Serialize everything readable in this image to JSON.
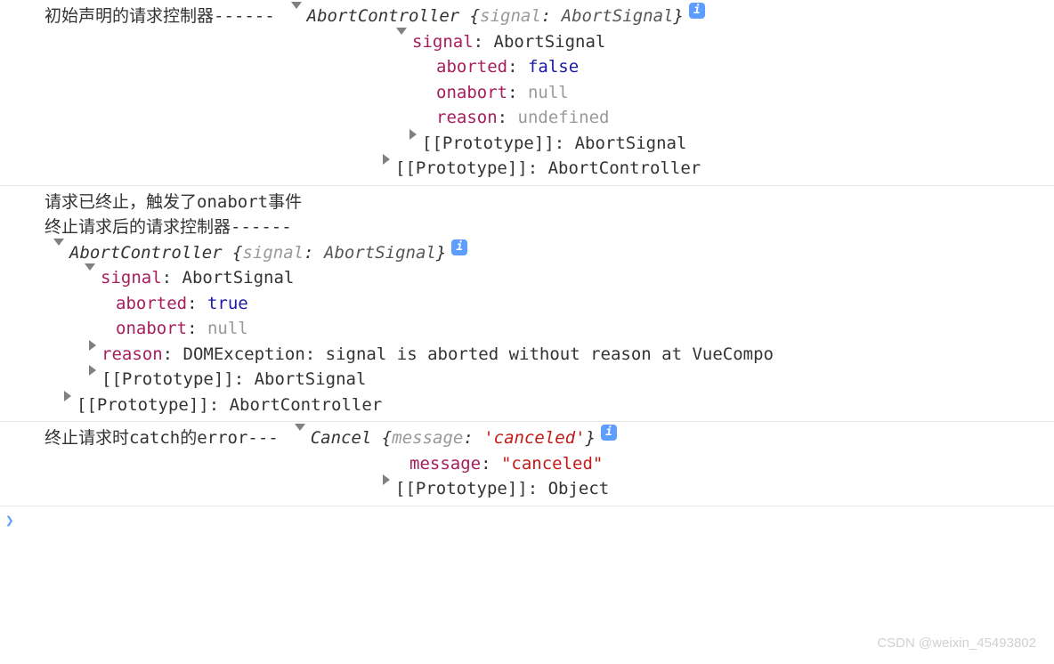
{
  "entry1": {
    "prefix": "初始声明的请求控制器------",
    "objName": "AbortController",
    "summaryKey": "signal",
    "summaryVal": "AbortSignal",
    "signal": {
      "key": "signal",
      "type": "AbortSignal",
      "aborted": {
        "key": "aborted",
        "val": "false"
      },
      "onabort": {
        "key": "onabort",
        "val": "null"
      },
      "reason": {
        "key": "reason",
        "val": "undefined"
      },
      "proto": {
        "key": "[[Prototype]]",
        "val": "AbortSignal"
      }
    },
    "proto": {
      "key": "[[Prototype]]",
      "val": "AbortController"
    }
  },
  "entry2": {
    "line1": "请求已终止，触发了onabort事件",
    "line2": "终止请求后的请求控制器------",
    "objName": "AbortController",
    "summaryKey": "signal",
    "summaryVal": "AbortSignal",
    "signal": {
      "key": "signal",
      "type": "AbortSignal",
      "aborted": {
        "key": "aborted",
        "val": "true"
      },
      "onabort": {
        "key": "onabort",
        "val": "null"
      },
      "reason": {
        "key": "reason",
        "val": "DOMException: signal is aborted without reason at VueCompo"
      },
      "proto": {
        "key": "[[Prototype]]",
        "val": "AbortSignal"
      }
    },
    "proto": {
      "key": "[[Prototype]]",
      "val": "AbortController"
    }
  },
  "entry3": {
    "prefix": "终止请求时catch的error---",
    "objName": "Cancel",
    "summaryKey": "message",
    "summaryVal": "'canceled'",
    "message": {
      "key": "message",
      "val": "\"canceled\""
    },
    "proto": {
      "key": "[[Prototype]]",
      "val": "Object"
    }
  },
  "watermark": "CSDN @weixin_45493802",
  "prompt": "❯"
}
